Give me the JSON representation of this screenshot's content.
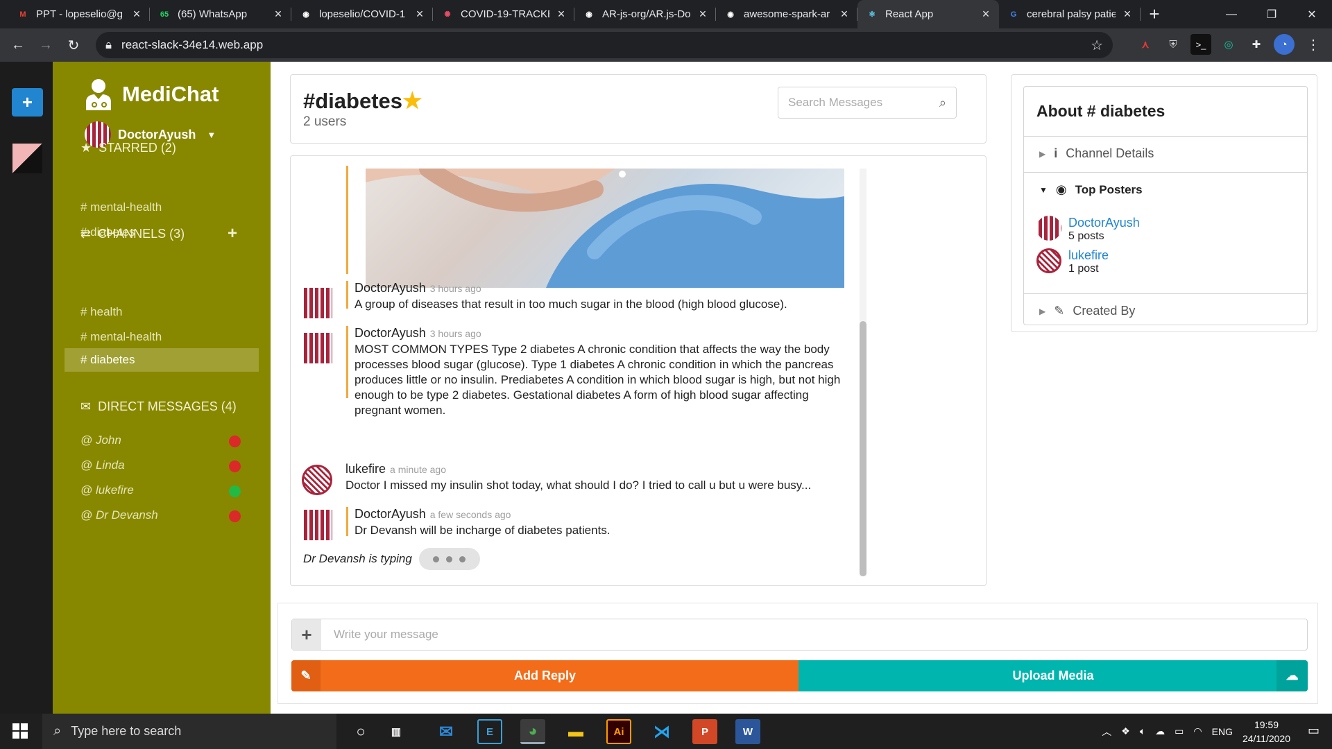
{
  "browser": {
    "tabs": [
      {
        "title": "PPT - lopeselio@g",
        "icon": "gmail-icon",
        "color": "#ea4335",
        "glyph": "M"
      },
      {
        "title": "(65) WhatsApp",
        "icon": "whatsapp-icon",
        "color": "#25d366",
        "glyph": "65"
      },
      {
        "title": "lopeselio/COVID-1",
        "icon": "github-icon",
        "color": "#ffffff",
        "glyph": "◉"
      },
      {
        "title": "COVID-19-TRACKE",
        "icon": "covid-icon",
        "color": "#e44c65",
        "glyph": "✺"
      },
      {
        "title": "AR-js-org/AR.js-Do",
        "icon": "github-icon",
        "color": "#ffffff",
        "glyph": "◉"
      },
      {
        "title": "awesome-spark-ar",
        "icon": "github-icon",
        "color": "#ffffff",
        "glyph": "◉"
      },
      {
        "title": "React App",
        "icon": "react-icon",
        "color": "#61dafb",
        "glyph": "⚛"
      },
      {
        "title": "cerebral palsy patie",
        "icon": "google-icon",
        "color": "#4285f4",
        "glyph": "G"
      }
    ],
    "active_tab": 6,
    "url": "react-slack-34e14.web.app"
  },
  "app": {
    "name": "MediChat",
    "user": "DoctorAyush",
    "starred_label": "STARRED (2)",
    "starred": [
      "# mental-health",
      "# diabetes"
    ],
    "channels_label": "CHANNELS (3)",
    "channels": [
      "# health",
      "# mental-health",
      "# diabetes"
    ],
    "active_channel": "# diabetes",
    "dm_label": "DIRECT MESSAGES (4)",
    "dms": [
      {
        "name": "@ John",
        "status": "offline",
        "color": "#db2828"
      },
      {
        "name": "@ Linda",
        "status": "offline",
        "color": "#db2828"
      },
      {
        "name": "@ lukefire",
        "status": "online",
        "color": "#21ba45"
      },
      {
        "name": "@ Dr Devansh",
        "status": "offline",
        "color": "#db2828"
      }
    ]
  },
  "header": {
    "title": "#diabetes",
    "users": "2 users",
    "search_placeholder": "Search Messages"
  },
  "messages": [
    {
      "author": "DoctorAyush",
      "time": "3 hours ago",
      "text": "A group of diseases that result in too much sugar in the blood (high blood glucose).",
      "avatar": "DoctorAyush"
    },
    {
      "author": "DoctorAyush",
      "time": "3 hours ago",
      "text": "MOST COMMON TYPES Type 2 diabetes A chronic condition that affects the way the body processes blood sugar (glucose). Type 1 diabetes A chronic condition in which the pancreas produces little or no insulin. Prediabetes A condition in which blood sugar is high, but not high enough to be type 2 diabetes. Gestational diabetes A form of high blood sugar affecting pregnant women.",
      "avatar": "DoctorAyush"
    },
    {
      "author": "lukefire",
      "time": "a minute ago",
      "text": "Doctor I missed my insulin shot today, what should I do? I tried to call u but u were busy...",
      "avatar": "lukefire"
    },
    {
      "author": "DoctorAyush",
      "time": "a few seconds ago",
      "text": "Dr Devansh will be incharge of diabetes patients.",
      "avatar": "DoctorAyush"
    }
  ],
  "typing": "Dr Devansh is typing",
  "about": {
    "title": "About # diabetes",
    "channel_details": "Channel Details",
    "top_posters": "Top Posters",
    "posters": [
      {
        "name": "DoctorAyush",
        "posts": "5 posts"
      },
      {
        "name": "lukefire",
        "posts": "1 post"
      }
    ],
    "created_by": "Created By"
  },
  "composer": {
    "placeholder": "Write your message",
    "reply_label": "Add Reply",
    "upload_label": "Upload Media"
  },
  "taskbar": {
    "search_placeholder": "Type here to search",
    "language": "ENG",
    "time": "19:59",
    "date": "24/11/2020"
  }
}
